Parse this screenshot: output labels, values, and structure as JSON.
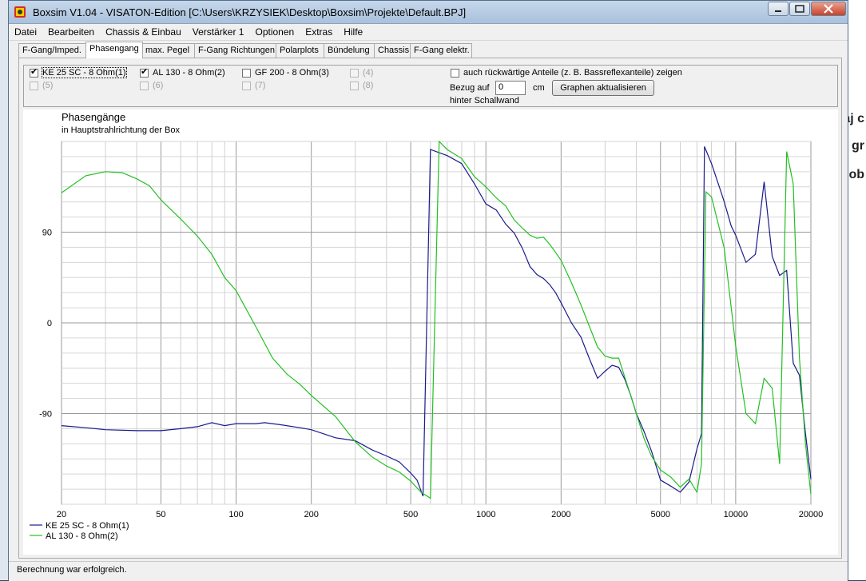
{
  "window": {
    "title": "Boxsim V1.04 - VISATON-Edition [C:\\Users\\KRZYSIEK\\Desktop\\Boxsim\\Projekte\\Default.BPJ]"
  },
  "menu": [
    "Datei",
    "Bearbeiten",
    "Chassis & Einbau",
    "Verstärker 1",
    "Optionen",
    "Extras",
    "Hilfe"
  ],
  "tabs": [
    "F-Gang/Imped.",
    "Phasengang",
    "max. Pegel",
    "F-Gang Richtungen",
    "Polarplots",
    "Bündelung",
    "Chassis",
    "F-Gang elektr."
  ],
  "active_tab": "Phasengang",
  "options": {
    "drivers": [
      {
        "label": "KE 25 SC - 8 Ohm(1)",
        "checked": true,
        "enabled": true
      },
      {
        "label": "AL 130 - 8 Ohm(2)",
        "checked": true,
        "enabled": true
      },
      {
        "label": "GF 200 - 8 Ohm(3)",
        "checked": false,
        "enabled": true
      },
      {
        "label": "(4)",
        "checked": false,
        "enabled": false
      },
      {
        "label": "(5)",
        "checked": false,
        "enabled": false
      },
      {
        "label": "(6)",
        "checked": false,
        "enabled": false
      },
      {
        "label": "(7)",
        "checked": false,
        "enabled": false
      },
      {
        "label": "(8)",
        "checked": false,
        "enabled": false
      }
    ],
    "reverse_label": "auch rückwärtige Anteile (z. B. Bassreflexanteile) zeigen",
    "reverse_checked": false,
    "ref_label": "Bezug auf",
    "ref_value": "0",
    "ref_unit": "cm",
    "ref_label2": "hinter Schallwand",
    "update_button": "Graphen aktualisieren"
  },
  "status": "Berechnung war erfolgreich.",
  "chart_data": {
    "type": "line",
    "title": "Phasengänge",
    "subtitle": "in Hauptstrahlrichtung der Box",
    "x_scale": "log",
    "xlim": [
      20,
      20000
    ],
    "ylim": [
      -180,
      180
    ],
    "x_ticks": [
      20,
      50,
      100,
      200,
      500,
      1000,
      2000,
      5000,
      10000,
      20000
    ],
    "y_ticks": [
      -90,
      0,
      90
    ],
    "legend_position": "bottom-left",
    "grid": true,
    "series": [
      {
        "name": "KE 25 SC - 8 Ohm(1)",
        "color": "#1a1a8c",
        "points": [
          [
            20,
            -102
          ],
          [
            25,
            -104
          ],
          [
            30,
            -106
          ],
          [
            40,
            -107
          ],
          [
            50,
            -107
          ],
          [
            60,
            -105
          ],
          [
            70,
            -103
          ],
          [
            80,
            -99
          ],
          [
            90,
            -102
          ],
          [
            100,
            -100
          ],
          [
            120,
            -100
          ],
          [
            130,
            -99
          ],
          [
            150,
            -101
          ],
          [
            180,
            -104
          ],
          [
            200,
            -106
          ],
          [
            250,
            -114
          ],
          [
            300,
            -117
          ],
          [
            350,
            -126
          ],
          [
            400,
            -132
          ],
          [
            450,
            -138
          ],
          [
            500,
            -149
          ],
          [
            530,
            -156
          ],
          [
            560,
            -172
          ],
          [
            600,
            172
          ],
          [
            700,
            166
          ],
          [
            800,
            158
          ],
          [
            900,
            138
          ],
          [
            1000,
            118
          ],
          [
            1100,
            112
          ],
          [
            1200,
            98
          ],
          [
            1300,
            89
          ],
          [
            1400,
            74
          ],
          [
            1500,
            56
          ],
          [
            1600,
            48
          ],
          [
            1700,
            44
          ],
          [
            1800,
            38
          ],
          [
            1900,
            30
          ],
          [
            2000,
            20
          ],
          [
            2200,
            0
          ],
          [
            2400,
            -14
          ],
          [
            2600,
            -36
          ],
          [
            2800,
            -55
          ],
          [
            3000,
            -48
          ],
          [
            3200,
            -42
          ],
          [
            3400,
            -44
          ],
          [
            3600,
            -56
          ],
          [
            3800,
            -72
          ],
          [
            4000,
            -90
          ],
          [
            4300,
            -108
          ],
          [
            4600,
            -127
          ],
          [
            5000,
            -156
          ],
          [
            5500,
            -162
          ],
          [
            6000,
            -168
          ],
          [
            6500,
            -158
          ],
          [
            7000,
            -125
          ],
          [
            7300,
            -110
          ],
          [
            7500,
            175
          ],
          [
            8000,
            158
          ],
          [
            8600,
            135
          ],
          [
            9000,
            120
          ],
          [
            9600,
            96
          ],
          [
            10000,
            87
          ],
          [
            11000,
            60
          ],
          [
            12000,
            68
          ],
          [
            13000,
            140
          ],
          [
            14000,
            66
          ],
          [
            15000,
            47
          ],
          [
            16000,
            52
          ],
          [
            17000,
            -40
          ],
          [
            18000,
            -52
          ],
          [
            19000,
            -108
          ],
          [
            20000,
            -155
          ]
        ]
      },
      {
        "name": "AL 130 - 8 Ohm(2)",
        "color": "#22c022",
        "points": [
          [
            20,
            129
          ],
          [
            25,
            146
          ],
          [
            30,
            150
          ],
          [
            35,
            149
          ],
          [
            40,
            143
          ],
          [
            45,
            136
          ],
          [
            50,
            122
          ],
          [
            60,
            103
          ],
          [
            70,
            86
          ],
          [
            80,
            68
          ],
          [
            90,
            45
          ],
          [
            100,
            32
          ],
          [
            120,
            -4
          ],
          [
            140,
            -35
          ],
          [
            160,
            -51
          ],
          [
            180,
            -61
          ],
          [
            200,
            -72
          ],
          [
            250,
            -93
          ],
          [
            300,
            -118
          ],
          [
            350,
            -133
          ],
          [
            400,
            -142
          ],
          [
            450,
            -148
          ],
          [
            500,
            -157
          ],
          [
            550,
            -168
          ],
          [
            600,
            -174
          ],
          [
            650,
            180
          ],
          [
            700,
            172
          ],
          [
            800,
            163
          ],
          [
            900,
            145
          ],
          [
            1000,
            135
          ],
          [
            1100,
            124
          ],
          [
            1200,
            116
          ],
          [
            1300,
            102
          ],
          [
            1400,
            94
          ],
          [
            1500,
            87
          ],
          [
            1600,
            84
          ],
          [
            1700,
            85
          ],
          [
            1800,
            78
          ],
          [
            1900,
            70
          ],
          [
            2000,
            62
          ],
          [
            2200,
            40
          ],
          [
            2400,
            18
          ],
          [
            2600,
            -4
          ],
          [
            2800,
            -24
          ],
          [
            3000,
            -33
          ],
          [
            3200,
            -35
          ],
          [
            3400,
            -35
          ],
          [
            3600,
            -54
          ],
          [
            3800,
            -72
          ],
          [
            4000,
            -90
          ],
          [
            4300,
            -115
          ],
          [
            4600,
            -132
          ],
          [
            5000,
            -146
          ],
          [
            5500,
            -153
          ],
          [
            6000,
            -163
          ],
          [
            6500,
            -155
          ],
          [
            7000,
            -168
          ],
          [
            7300,
            -140
          ],
          [
            7600,
            130
          ],
          [
            8000,
            125
          ],
          [
            8600,
            94
          ],
          [
            9000,
            74
          ],
          [
            9600,
            15
          ],
          [
            10000,
            -23
          ],
          [
            11000,
            -90
          ],
          [
            12000,
            -100
          ],
          [
            13000,
            -55
          ],
          [
            14000,
            -65
          ],
          [
            15000,
            -140
          ],
          [
            16000,
            170
          ],
          [
            17000,
            138
          ],
          [
            18000,
            -35
          ],
          [
            19000,
            -118
          ],
          [
            20000,
            -170
          ]
        ]
      }
    ]
  }
}
